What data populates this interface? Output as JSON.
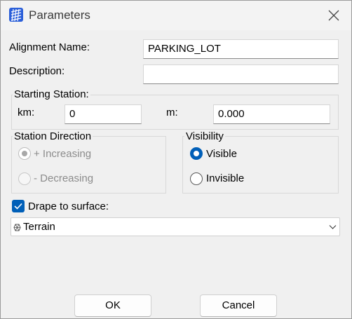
{
  "window": {
    "title": "Parameters",
    "icon": "app-grid-icon",
    "close_icon": "close-icon"
  },
  "form": {
    "alignment_name_label": "Alignment Name:",
    "alignment_name_value": "PARKING_LOT",
    "description_label": "Description:",
    "description_value": ""
  },
  "starting_station": {
    "title": "Starting Station:",
    "km_label": "km:",
    "km_value": "0",
    "m_label": "m:",
    "m_value": "0.000"
  },
  "station_direction": {
    "title": "Station Direction",
    "increasing_label": "+ Increasing",
    "decreasing_label": "- Decreasing",
    "selected": "increasing",
    "enabled": false
  },
  "visibility": {
    "title": "Visibility",
    "visible_label": "Visible",
    "invisible_label": "Invisible",
    "selected": "visible"
  },
  "drape": {
    "label": "Drape to surface:",
    "checked": true,
    "surface_value": "Terrain",
    "surface_icon": "terrain-icon"
  },
  "buttons": {
    "ok_label": "OK",
    "cancel_label": "Cancel"
  },
  "colors": {
    "accent": "#005fb8",
    "disabled_text": "#8c8c8c",
    "dialog_bg": "#f0f0f0"
  }
}
